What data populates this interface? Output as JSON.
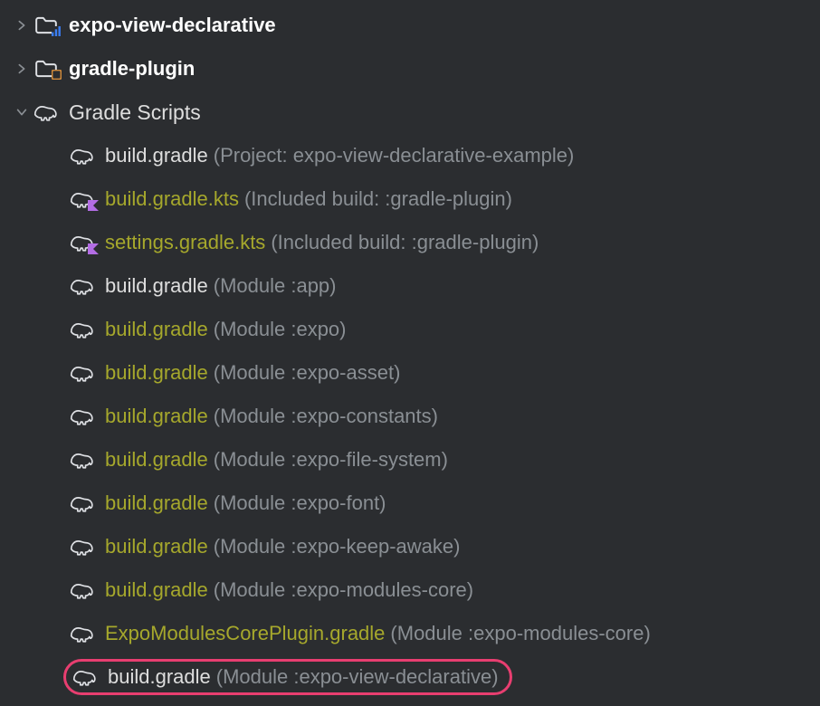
{
  "root": [
    {
      "label": "expo-view-declarative",
      "bold": true,
      "expanded": false,
      "icon": "folder-badge",
      "badge_color": "#3a7df3"
    },
    {
      "label": "gradle-plugin",
      "bold": true,
      "expanded": false,
      "icon": "folder-badge",
      "badge_color": "#d08a3a"
    }
  ],
  "scripts_header": {
    "label": "Gradle Scripts",
    "expanded": true
  },
  "scripts": [
    {
      "name": "build.gradle",
      "desc": "(Project: expo-view-declarative-example)",
      "olive": false,
      "icon": "gradle"
    },
    {
      "name": "build.gradle.kts",
      "desc": "(Included build: :gradle-plugin)",
      "olive": true,
      "icon": "gradle-k"
    },
    {
      "name": "settings.gradle.kts",
      "desc": "(Included build: :gradle-plugin)",
      "olive": true,
      "icon": "gradle-k"
    },
    {
      "name": "build.gradle",
      "desc": "(Module :app)",
      "olive": false,
      "icon": "gradle"
    },
    {
      "name": "build.gradle",
      "desc": "(Module :expo)",
      "olive": true,
      "icon": "gradle"
    },
    {
      "name": "build.gradle",
      "desc": "(Module :expo-asset)",
      "olive": true,
      "icon": "gradle"
    },
    {
      "name": "build.gradle",
      "desc": "(Module :expo-constants)",
      "olive": true,
      "icon": "gradle"
    },
    {
      "name": "build.gradle",
      "desc": "(Module :expo-file-system)",
      "olive": true,
      "icon": "gradle"
    },
    {
      "name": "build.gradle",
      "desc": "(Module :expo-font)",
      "olive": true,
      "icon": "gradle"
    },
    {
      "name": "build.gradle",
      "desc": "(Module :expo-keep-awake)",
      "olive": true,
      "icon": "gradle"
    },
    {
      "name": "build.gradle",
      "desc": "(Module :expo-modules-core)",
      "olive": true,
      "icon": "gradle"
    },
    {
      "name": "ExpoModulesCorePlugin.gradle",
      "desc": "(Module :expo-modules-core)",
      "olive": true,
      "icon": "gradle"
    },
    {
      "name": "build.gradle",
      "desc": "(Module :expo-view-declarative)",
      "olive": false,
      "icon": "gradle",
      "highlight": true
    }
  ]
}
